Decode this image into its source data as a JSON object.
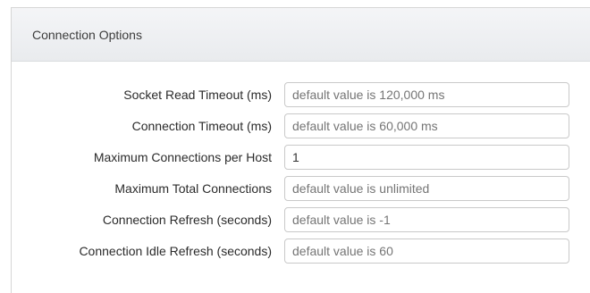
{
  "section": {
    "title": "Connection Options"
  },
  "fields": [
    {
      "label": "Socket Read Timeout (ms)",
      "placeholder": "default value is 120,000 ms",
      "value": ""
    },
    {
      "label": "Connection Timeout (ms)",
      "placeholder": "default value is 60,000 ms",
      "value": ""
    },
    {
      "label": "Maximum Connections per Host",
      "placeholder": "",
      "value": "1"
    },
    {
      "label": "Maximum Total Connections",
      "placeholder": "default value is unlimited",
      "value": ""
    },
    {
      "label": "Connection Refresh (seconds)",
      "placeholder": "default value is -1",
      "value": ""
    },
    {
      "label": "Connection Idle Refresh (seconds)",
      "placeholder": "default value is 60",
      "value": ""
    }
  ]
}
